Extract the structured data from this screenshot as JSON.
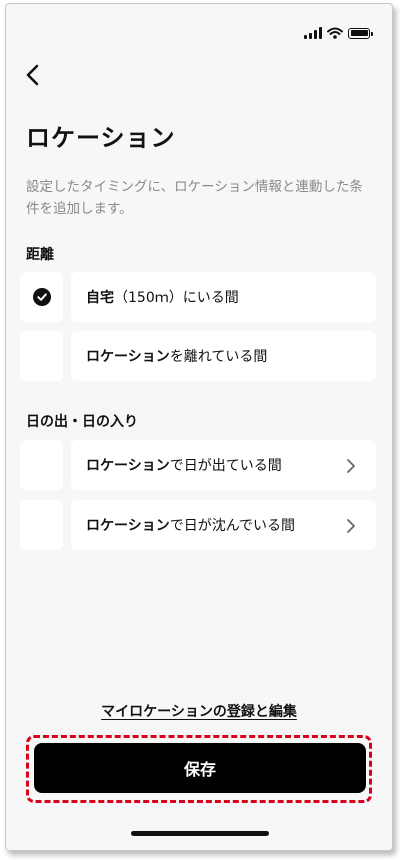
{
  "header": {
    "title": "ロケーション",
    "description": "設定したタイミングに、ロケーション情報と連動した条件を追加します。"
  },
  "sections": [
    {
      "heading": "距離",
      "items": [
        {
          "label_bold": "自宅",
          "label_rest": "（150ｍ）にいる間",
          "checked": true
        },
        {
          "label_bold": "ロケーション",
          "label_rest": "を離れている間",
          "checked": false
        }
      ]
    },
    {
      "heading": "日の出・日の入り",
      "items": [
        {
          "label_bold": "ロケーション",
          "label_rest": "で日が出ている間",
          "checked": false,
          "chevron": true
        },
        {
          "label_bold": "ロケーション",
          "label_rest": "で日が沈んでいる間",
          "checked": false,
          "chevron": true
        }
      ]
    }
  ],
  "footer": {
    "link": "マイロケーションの登録と編集",
    "save_label": "保存"
  },
  "colors": {
    "highlight": "#d9001b",
    "button": "#000000",
    "background": "#f7f7f7"
  }
}
